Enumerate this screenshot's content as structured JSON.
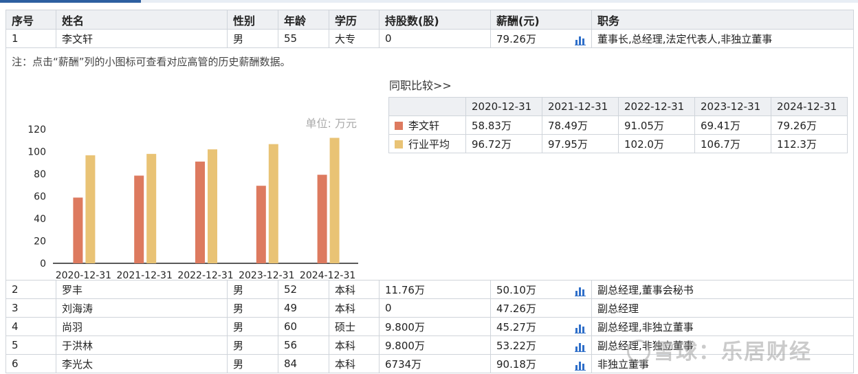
{
  "columns": [
    "序号",
    "姓名",
    "性别",
    "年龄",
    "学历",
    "持股数(股)",
    "薪酬(元)",
    "职务"
  ],
  "rows": [
    {
      "no": "1",
      "name": "李文轩",
      "gender": "男",
      "age": "55",
      "edu": "大专",
      "shares": "0",
      "salary": "79.26万",
      "has_icon": true,
      "role": "董事长,总经理,法定代表人,非独立董事"
    },
    {
      "no": "2",
      "name": "罗丰",
      "gender": "男",
      "age": "52",
      "edu": "本科",
      "shares": "11.76万",
      "salary": "50.10万",
      "has_icon": true,
      "role": "副总经理,董事会秘书"
    },
    {
      "no": "3",
      "name": "刘海涛",
      "gender": "男",
      "age": "49",
      "edu": "本科",
      "shares": "0",
      "salary": "47.26万",
      "has_icon": false,
      "role": "副总经理"
    },
    {
      "no": "4",
      "name": "尚羽",
      "gender": "男",
      "age": "60",
      "edu": "硕士",
      "shares": "9.800万",
      "salary": "45.27万",
      "has_icon": true,
      "role": "副总经理,非独立董事"
    },
    {
      "no": "5",
      "name": "于洪林",
      "gender": "男",
      "age": "56",
      "edu": "本科",
      "shares": "9.800万",
      "salary": "53.22万",
      "has_icon": true,
      "role": "副总经理,非独立董事"
    },
    {
      "no": "6",
      "name": "李光太",
      "gender": "男",
      "age": "84",
      "edu": "本科",
      "shares": "6734万",
      "salary": "90.18万",
      "has_icon": true,
      "role": "非独立董事"
    }
  ],
  "detail": {
    "note": "注：点击“薪酬”列的小图标可查看对应高管的历史薪酬数据。",
    "compare_title": "同职比较>>",
    "compare_table": {
      "years": [
        "2020-12-31",
        "2021-12-31",
        "2022-12-31",
        "2023-12-31",
        "2024-12-31"
      ],
      "rows": [
        {
          "label": "李文轩",
          "color": "#dd7a5f",
          "values": [
            "58.83万",
            "78.49万",
            "91.05万",
            "69.41万",
            "79.26万"
          ]
        },
        {
          "label": "行业平均",
          "color": "#e9c375",
          "values": [
            "96.72万",
            "97.95万",
            "102.0万",
            "106.7万",
            "112.3万"
          ]
        }
      ]
    }
  },
  "chart_data": {
    "type": "bar",
    "unit_label": "单位: 万元",
    "categories": [
      "2020-12-31",
      "2021-12-31",
      "2022-12-31",
      "2023-12-31",
      "2024-12-31"
    ],
    "series": [
      {
        "name": "李文轩",
        "color": "#dd7a5f",
        "values": [
          58.83,
          78.49,
          91.05,
          69.41,
          79.26
        ]
      },
      {
        "name": "行业平均",
        "color": "#e9c375",
        "values": [
          96.72,
          97.95,
          102.0,
          106.7,
          112.3
        ]
      }
    ],
    "yticks": [
      0,
      20,
      40,
      60,
      80,
      100,
      120
    ],
    "ylim": [
      0,
      120
    ],
    "legend": "bottom",
    "grid": false
  },
  "watermark": "雪球：乐居财经"
}
